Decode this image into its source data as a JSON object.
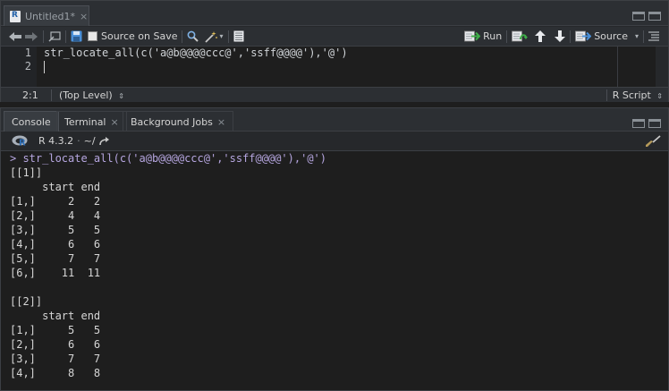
{
  "editor": {
    "tab_label": "Untitled1*",
    "tab_close": "×",
    "toolbar": {
      "source_on_save_label": "Source on Save",
      "run_label": "Run",
      "source_label": "Source"
    },
    "code_lines": [
      "str_locate_all(c('a@b@@@@ccc@','ssff@@@@'),'@')",
      ""
    ],
    "line_numbers": [
      "1",
      "2"
    ],
    "status": {
      "position": "2:1",
      "scope": "(Top Level)",
      "file_type": "R Script"
    }
  },
  "console": {
    "tabs": [
      {
        "label": "Console"
      },
      {
        "label": "Terminal",
        "close": "×"
      },
      {
        "label": "Background Jobs",
        "close": "×"
      }
    ],
    "r_version": "R 4.3.2",
    "working_dir": "~/",
    "output_lines": [
      "> str_locate_all(c('a@b@@@@ccc@','ssff@@@@'),'@')",
      "[[1]]",
      "     start end",
      "[1,]     2   2",
      "[2,]     4   4",
      "[3,]     5   5",
      "[4,]     6   6",
      "[5,]     7   7",
      "[6,]    11  11",
      "",
      "[[2]]",
      "     start end",
      "[1,]     5   5",
      "[2,]     6   6",
      "[3,]     7   7",
      "[4,]     8   8"
    ]
  },
  "colors": {
    "accent_blue": "#4a90d9",
    "arrow_green": "#3fae49",
    "string_pink": "#d2a0c8",
    "background": "#1e1e1e"
  }
}
